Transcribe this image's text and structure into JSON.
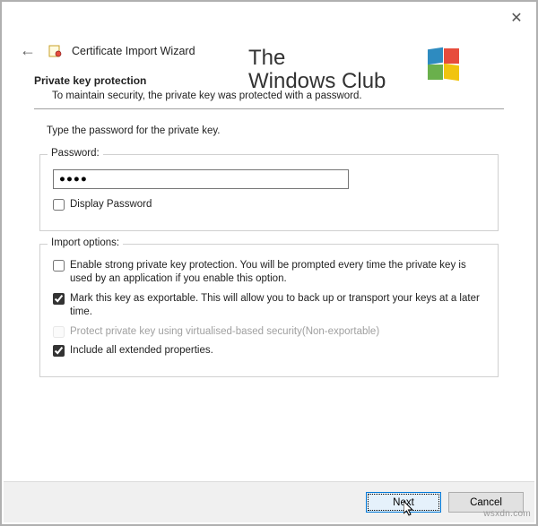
{
  "window": {
    "title": "Certificate Import Wizard"
  },
  "watermark": {
    "line1": "The",
    "line2": "Windows Club"
  },
  "page": {
    "heading": "Private key protection",
    "subheading": "To maintain security, the private key was protected with a password.",
    "instruction": "Type the password for the private key."
  },
  "password": {
    "legend": "Password:",
    "value": "●●●●",
    "display_label": "Display Password",
    "display_checked": false
  },
  "options": {
    "legend": "Import options:",
    "strong_protection": {
      "label": "Enable strong private key protection. You will be prompted every time the private key is used by an application if you enable this option.",
      "checked": false
    },
    "exportable": {
      "label": "Mark this key as exportable. This will allow you to back up or transport your keys at a later time.",
      "checked": true
    },
    "vbs": {
      "label": "Protect private key using virtualised-based security(Non-exportable)",
      "checked": false,
      "disabled": true
    },
    "extended": {
      "label": "Include all extended properties.",
      "checked": true
    }
  },
  "buttons": {
    "next": "Next",
    "cancel": "Cancel"
  },
  "attribution": "wsxdn.com"
}
